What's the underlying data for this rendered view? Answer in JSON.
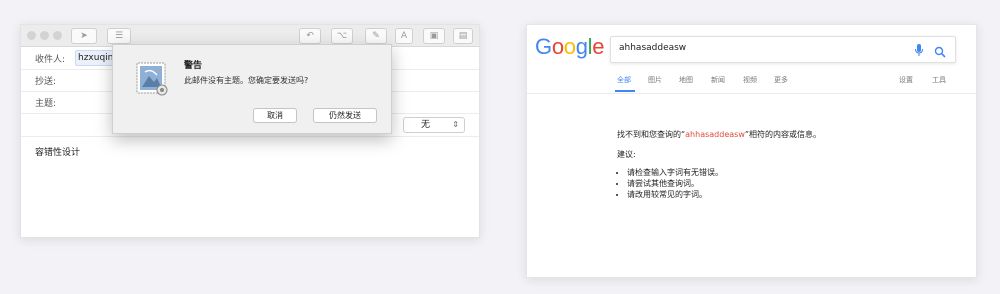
{
  "mail": {
    "fields": {
      "to_label": "收件人:",
      "to_value": "hzxuqin",
      "cc_label": "抄送:",
      "subject_label": "主题:"
    },
    "select_value": "无",
    "body_text": "容错性设计",
    "alert": {
      "title": "警告",
      "message": "此邮件没有主题。您确定要发送吗?",
      "cancel_label": "取消",
      "send_label": "仍然发送"
    }
  },
  "google": {
    "logo_letters": [
      "G",
      "o",
      "o",
      "g",
      "l",
      "e"
    ],
    "logo_colors": [
      "#4285F4",
      "#EA4335",
      "#FBBC05",
      "#4285F4",
      "#34A853",
      "#EA4335"
    ],
    "query": "ahhasaddeasw",
    "tabs": [
      "全部",
      "图片",
      "地图",
      "新闻",
      "视频",
      "更多"
    ],
    "tools": [
      "设置",
      "工具"
    ],
    "result": {
      "not_found_prefix": "找不到和您查询的“",
      "not_found_query": "ahhasaddeasw",
      "not_found_suffix": "”相符的内容或信息。",
      "suggest_label": "建议:",
      "suggestions": [
        "请检查输入字词有无错误。",
        "请尝试其他查询词。",
        "请改用较常见的字词。"
      ]
    }
  }
}
